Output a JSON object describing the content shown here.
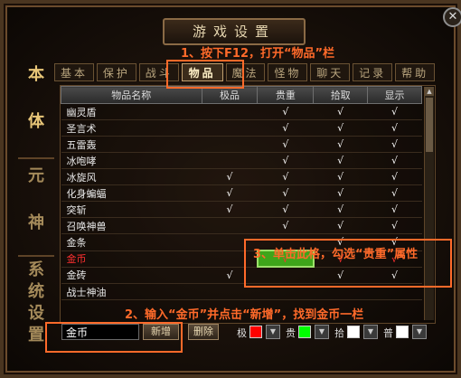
{
  "window": {
    "title": "游戏设置",
    "close": "✕"
  },
  "side_nav": [
    {
      "label": "本",
      "active": true
    },
    {
      "label": "体",
      "active": true
    },
    {
      "label": "元",
      "active": false
    },
    {
      "label": "神",
      "active": false
    },
    {
      "label": "系",
      "active": false
    },
    {
      "label": "统",
      "active": false
    },
    {
      "label": "设",
      "active": false
    },
    {
      "label": "置",
      "active": false
    }
  ],
  "tabs": [
    "基本",
    "保护",
    "战斗",
    "物品",
    "魔法",
    "怪物",
    "聊天",
    "记录",
    "帮助"
  ],
  "active_tab": "物品",
  "table": {
    "headers": [
      "物品名称",
      "极品",
      "贵重",
      "拾取",
      "显示"
    ],
    "rows": [
      {
        "name": "幽灵盾",
        "jipin": "",
        "guizhong": "√",
        "shiqu": "√",
        "xianshi": "√"
      },
      {
        "name": "圣言术",
        "jipin": "",
        "guizhong": "√",
        "shiqu": "√",
        "xianshi": "√"
      },
      {
        "name": "五雷轰",
        "jipin": "",
        "guizhong": "√",
        "shiqu": "√",
        "xianshi": "√"
      },
      {
        "name": "冰咆哮",
        "jipin": "",
        "guizhong": "√",
        "shiqu": "√",
        "xianshi": "√"
      },
      {
        "name": "冰旋风",
        "jipin": "√",
        "guizhong": "√",
        "shiqu": "√",
        "xianshi": "√"
      },
      {
        "name": "化身蝙蝠",
        "jipin": "√",
        "guizhong": "√",
        "shiqu": "√",
        "xianshi": "√"
      },
      {
        "name": "突斩",
        "jipin": "√",
        "guizhong": "√",
        "shiqu": "√",
        "xianshi": "√"
      },
      {
        "name": "召唤神兽",
        "jipin": "",
        "guizhong": "√",
        "shiqu": "√",
        "xianshi": "√"
      },
      {
        "name": "金条",
        "jipin": "",
        "guizhong": "",
        "shiqu": "√",
        "xianshi": "√"
      },
      {
        "name": "金币",
        "jipin": "",
        "guizhong": "√",
        "shiqu": "√",
        "xianshi": "√"
      },
      {
        "name": "金砖",
        "jipin": "√",
        "guizhong": "",
        "shiqu": "√",
        "xianshi": "√"
      },
      {
        "name": "战士神油",
        "jipin": "",
        "guizhong": "",
        "shiqu": "",
        "xianshi": ""
      }
    ]
  },
  "bottom": {
    "name_value": "金币",
    "add_button": "新增",
    "delete_button": "删除",
    "labels": [
      "极",
      "贵",
      "拾",
      "普"
    ],
    "colors": [
      "#ff0000",
      "#00ff00",
      "#ffffff",
      "#ffffff"
    ]
  },
  "annotations": {
    "step1": "1、按下F12，打开“物品”栏",
    "step2": "2、输入“金币”并点击“新增”，找到金币一栏",
    "step3": "3、单击此格，勾选“贵重”属性"
  }
}
